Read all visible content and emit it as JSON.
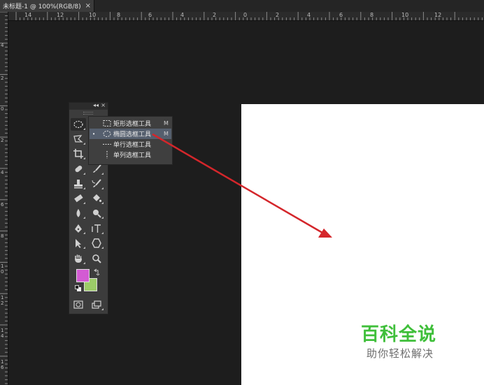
{
  "document_tab": {
    "title": "未标题-1 @ 100%(RGB/8)",
    "close_glyph": "×"
  },
  "rulers": {
    "horizontal_labels": [
      "14",
      "12",
      "10",
      "8",
      "6",
      "4",
      "2",
      "0",
      "2",
      "4",
      "6",
      "8",
      "10",
      "12"
    ],
    "vertical_labels": [
      "4",
      "2",
      "0",
      "2",
      "4",
      "6",
      "8",
      "1 0",
      "1 2",
      "1 4",
      "1 6"
    ]
  },
  "tools_panel": {
    "collapse_glyph": "◂◂",
    "close_glyph": "×",
    "tools": [
      "elliptical-marquee-tool",
      "move-tool",
      "lasso-tool",
      "quick-selection-tool",
      "crop-tool",
      "eyedropper-tool",
      "spot-healing-brush-tool",
      "brush-tool",
      "clone-stamp-tool",
      "history-brush-tool",
      "eraser-tool",
      "paint-bucket-tool",
      "blur-tool",
      "dodge-tool",
      "pen-tool",
      "type-tool",
      "path-selection-tool",
      "shape-tool",
      "hand-tool",
      "zoom-tool"
    ],
    "foreground_color": "#d35bd3",
    "background_color": "#9ccc68"
  },
  "marquee_flyout": {
    "items": [
      {
        "label": "矩形选框工具",
        "shortcut": "M",
        "icon": "rect-marquee-icon",
        "selected": false
      },
      {
        "label": "椭圆选框工具",
        "shortcut": "M",
        "icon": "ellipse-marquee-icon",
        "selected": true
      },
      {
        "label": "单行选框工具",
        "shortcut": "",
        "icon": "single-row-marquee-icon",
        "selected": false
      },
      {
        "label": "单列选框工具",
        "shortcut": "",
        "icon": "single-column-marquee-icon",
        "selected": false
      }
    ],
    "selected_bullet": "•"
  },
  "annotation": {
    "arrow_color": "#d4262b"
  },
  "watermark": {
    "title": "百科全说",
    "subtitle": "助你轻松解决",
    "title_color": "#3fbf3a"
  }
}
